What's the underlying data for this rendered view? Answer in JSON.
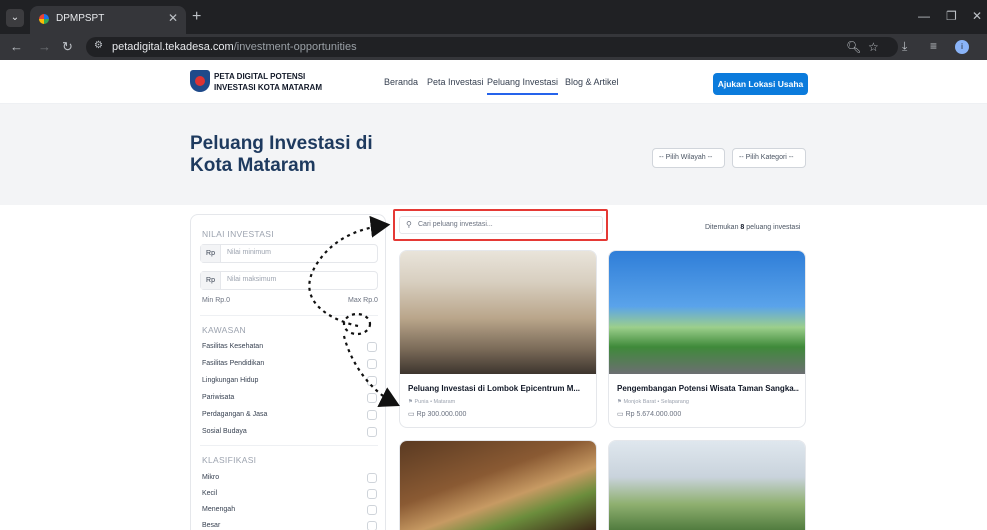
{
  "browser": {
    "tab_title": "DPMPSPT",
    "url_host": "petadigital.tekadesa.com",
    "url_path": "/investment-opportunities"
  },
  "site": {
    "brand_line1": "PETA DIGITAL POTENSI",
    "brand_line2": "INVESTASI KOTA MATARAM",
    "nav": [
      "Beranda",
      "Peta Investasi",
      "Peluang Investasi",
      "Blog & Artikel"
    ],
    "cta": "Ajukan Lokasi Usaha"
  },
  "hero": {
    "title": "Peluang Investasi di Kota Mataram",
    "region_select": "-- Pilih Wilayah --",
    "category_select": "-- Pilih Kategori --"
  },
  "filter": {
    "investment_title": "NILAI INVESTASI",
    "currency_prefix": "Rp",
    "min_placeholder": "Nilai minimum",
    "max_placeholder": "Nilai maksimum",
    "min_label": "Min Rp.0",
    "max_label": "Max Rp.0",
    "kawasan_title": "KAWASAN",
    "kawasan_items": [
      "Fasilitas Kesehatan",
      "Fasilitas Pendidikan",
      "Lingkungan Hidup",
      "Pariwisata",
      "Perdagangan & Jasa",
      "Sosial Budaya"
    ],
    "klasifikasi_title": "KLASIFIKASI",
    "klasifikasi_items": [
      "Mikro",
      "Kecil",
      "Menengah",
      "Besar"
    ]
  },
  "results": {
    "search_placeholder": "Cari peluang investasi...",
    "found_prefix": "Ditemukan",
    "found_count": "8",
    "found_suffix": "peluang investasi",
    "cards": [
      {
        "title": "Peluang Investasi di Lombok Epicentrum M...",
        "meta": "Punia • Mataram",
        "price": "Rp 300.000.000"
      },
      {
        "title": "Pengembangan Potensi Wisata Taman Sangka...",
        "meta": "Monjok Barat • Selaparang",
        "price": "Rp 5.674.000.000"
      }
    ]
  },
  "colors": {
    "accent": "#0b7bdc",
    "hero_title": "#1e3a5f",
    "highlight": "#e53935"
  }
}
